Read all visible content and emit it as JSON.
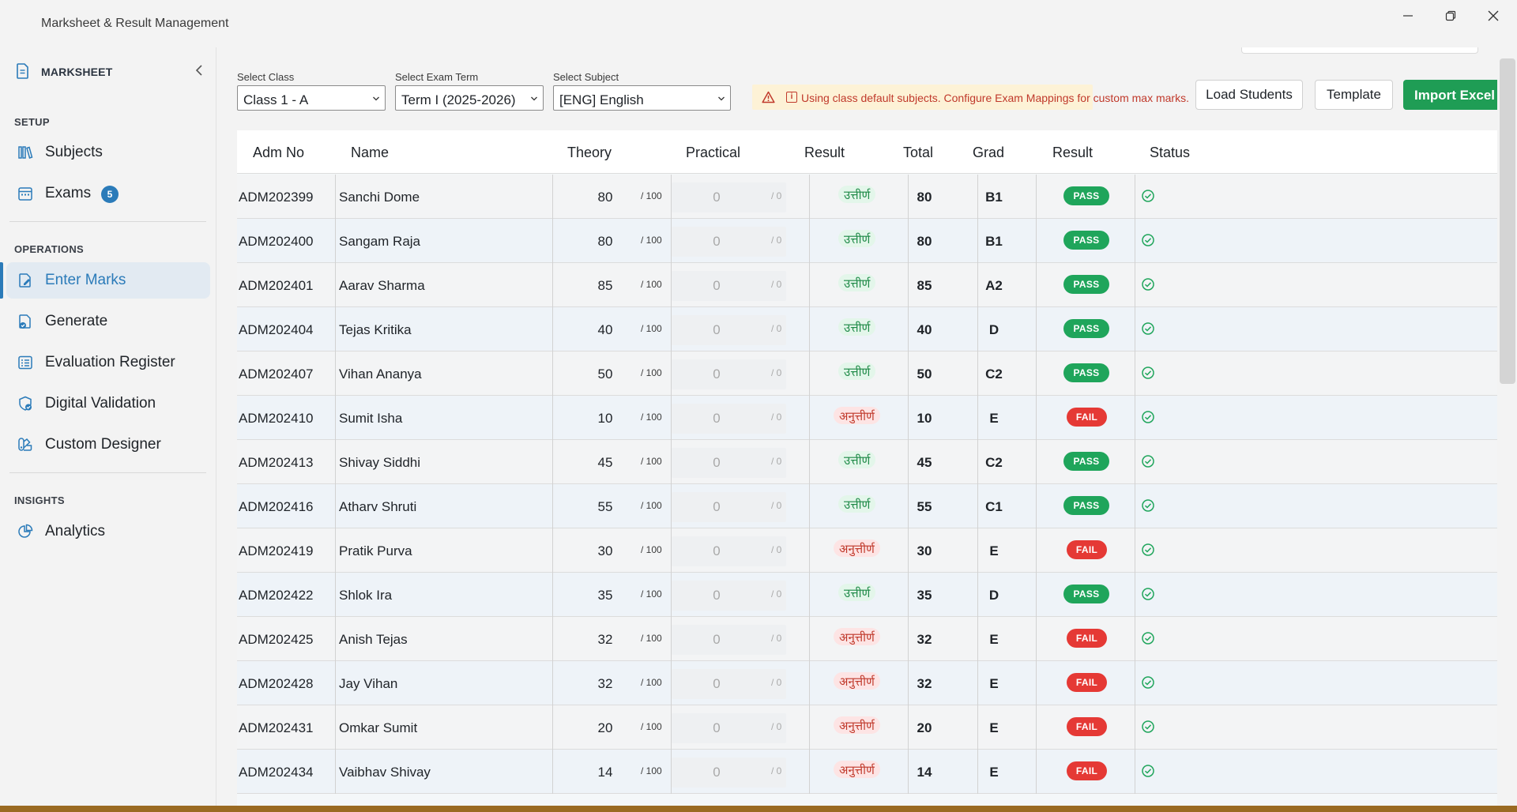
{
  "app": {
    "title": "Marksheet & Result Management"
  },
  "sidebar": {
    "brand": "MARKSHEET",
    "sections": {
      "setup": "SETUP",
      "operations": "OPERATIONS",
      "insights": "INSIGHTS"
    },
    "items": {
      "subjects": "Subjects",
      "exams": "Exams",
      "exams_badge": "5",
      "enter_marks": "Enter Marks",
      "generate": "Generate",
      "evaluation_register": "Evaluation Register",
      "digital_validation": "Digital Validation",
      "custom_designer": "Custom Designer",
      "analytics": "Analytics"
    }
  },
  "filters": {
    "class_label": "Select Class",
    "class_value": "Class 1 - A",
    "term_label": "Select Exam Term",
    "term_value": "Term I (2025-2026)",
    "subject_label": "Select Subject",
    "subject_value": "[ENG] English"
  },
  "warning": {
    "text": "Using class default subjects. Configure Exam Mappings for custom max marks."
  },
  "toolbar": {
    "load_students": "Load Students",
    "template": "Template",
    "import_excel": "Import Excel"
  },
  "colors": {
    "accent": "#2b7bb9",
    "pass": "#1fa55b",
    "fail": "#e53935",
    "warning_text": "#c0392b",
    "primary_button": "#1f9d55"
  },
  "table": {
    "headers": {
      "adm_no": "Adm No",
      "name": "Name",
      "theory": "Theory",
      "practical": "Practical",
      "result_hi": "Result",
      "total": "Total",
      "grade": "Grad",
      "result": "Result",
      "status": "Status"
    },
    "rows": [
      {
        "adm": "ADM202399",
        "name": "Sanchi Dome",
        "theory": "80",
        "theory_max": "/ 100",
        "practical": "0",
        "practical_max": "/ 0",
        "result_hi": "उत्तीर्ण",
        "total": "80",
        "grade": "B1",
        "result": "PASS",
        "status_icon": "check-circle-icon"
      },
      {
        "adm": "ADM202400",
        "name": "Sangam Raja",
        "theory": "80",
        "theory_max": "/ 100",
        "practical": "0",
        "practical_max": "/ 0",
        "result_hi": "उत्तीर्ण",
        "total": "80",
        "grade": "B1",
        "result": "PASS",
        "status_icon": "check-circle-icon"
      },
      {
        "adm": "ADM202401",
        "name": "Aarav Sharma",
        "theory": "85",
        "theory_max": "/ 100",
        "practical": "0",
        "practical_max": "/ 0",
        "result_hi": "उत्तीर्ण",
        "total": "85",
        "grade": "A2",
        "result": "PASS",
        "status_icon": "check-circle-icon"
      },
      {
        "adm": "ADM202404",
        "name": "Tejas Kritika",
        "theory": "40",
        "theory_max": "/ 100",
        "practical": "0",
        "practical_max": "/ 0",
        "result_hi": "उत्तीर्ण",
        "total": "40",
        "grade": "D",
        "result": "PASS",
        "status_icon": "check-circle-icon"
      },
      {
        "adm": "ADM202407",
        "name": "Vihan Ananya",
        "theory": "50",
        "theory_max": "/ 100",
        "practical": "0",
        "practical_max": "/ 0",
        "result_hi": "उत्तीर्ण",
        "total": "50",
        "grade": "C2",
        "result": "PASS",
        "status_icon": "check-circle-icon"
      },
      {
        "adm": "ADM202410",
        "name": "Sumit Isha",
        "theory": "10",
        "theory_max": "/ 100",
        "practical": "0",
        "practical_max": "/ 0",
        "result_hi": "अनुत्तीर्ण",
        "total": "10",
        "grade": "E",
        "result": "FAIL",
        "status_icon": "check-circle-icon"
      },
      {
        "adm": "ADM202413",
        "name": "Shivay Siddhi",
        "theory": "45",
        "theory_max": "/ 100",
        "practical": "0",
        "practical_max": "/ 0",
        "result_hi": "उत्तीर्ण",
        "total": "45",
        "grade": "C2",
        "result": "PASS",
        "status_icon": "check-circle-icon"
      },
      {
        "adm": "ADM202416",
        "name": "Atharv Shruti",
        "theory": "55",
        "theory_max": "/ 100",
        "practical": "0",
        "practical_max": "/ 0",
        "result_hi": "उत्तीर्ण",
        "total": "55",
        "grade": "C1",
        "result": "PASS",
        "status_icon": "check-circle-icon"
      },
      {
        "adm": "ADM202419",
        "name": "Pratik Purva",
        "theory": "30",
        "theory_max": "/ 100",
        "practical": "0",
        "practical_max": "/ 0",
        "result_hi": "अनुत्तीर्ण",
        "total": "30",
        "grade": "E",
        "result": "FAIL",
        "status_icon": "check-circle-icon"
      },
      {
        "adm": "ADM202422",
        "name": "Shlok Ira",
        "theory": "35",
        "theory_max": "/ 100",
        "practical": "0",
        "practical_max": "/ 0",
        "result_hi": "उत्तीर्ण",
        "total": "35",
        "grade": "D",
        "result": "PASS",
        "status_icon": "check-circle-icon"
      },
      {
        "adm": "ADM202425",
        "name": "Anish Tejas",
        "theory": "32",
        "theory_max": "/ 100",
        "practical": "0",
        "practical_max": "/ 0",
        "result_hi": "अनुत्तीर्ण",
        "total": "32",
        "grade": "E",
        "result": "FAIL",
        "status_icon": "check-circle-icon"
      },
      {
        "adm": "ADM202428",
        "name": "Jay Vihan",
        "theory": "32",
        "theory_max": "/ 100",
        "practical": "0",
        "practical_max": "/ 0",
        "result_hi": "अनुत्तीर्ण",
        "total": "32",
        "grade": "E",
        "result": "FAIL",
        "status_icon": "check-circle-icon"
      },
      {
        "adm": "ADM202431",
        "name": "Omkar Sumit",
        "theory": "20",
        "theory_max": "/ 100",
        "practical": "0",
        "practical_max": "/ 0",
        "result_hi": "अनुत्तीर्ण",
        "total": "20",
        "grade": "E",
        "result": "FAIL",
        "status_icon": "check-circle-icon"
      },
      {
        "adm": "ADM202434",
        "name": "Vaibhav Shivay",
        "theory": "14",
        "theory_max": "/ 100",
        "practical": "0",
        "practical_max": "/ 0",
        "result_hi": "अनुत्तीर्ण",
        "total": "14",
        "grade": "E",
        "result": "FAIL",
        "status_icon": "check-circle-icon"
      }
    ]
  }
}
